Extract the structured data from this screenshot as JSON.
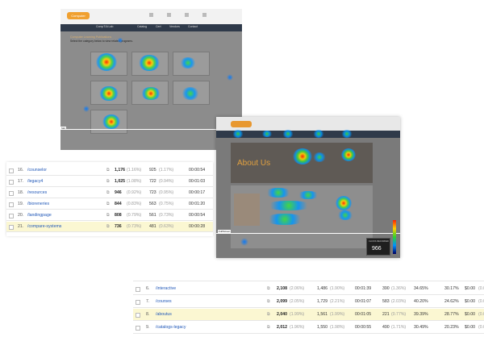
{
  "shot1": {
    "logo": "Computer",
    "nav": [
      "CompTIA Lab",
      "Catalog",
      "Cert",
      "Vendors",
      "Contact"
    ],
    "page_heading": "Computer Learning Publications",
    "page_subheading": "Select the category below to view related programs.",
    "label": "fold"
  },
  "shot2": {
    "hero_title": "About Us",
    "corner_label": "FullScreen",
    "clicks_label": "CLICKS RECORDED",
    "clicks_value": "966"
  },
  "table_top": {
    "rows": [
      {
        "idx": "16.",
        "url": "/counselor",
        "v1": "1,176",
        "p1": "(1.16%)",
        "v2": "925",
        "p2": "(1.17%)",
        "t": "00:00:54"
      },
      {
        "idx": "17.",
        "url": "/legacy4",
        "v1": "1,025",
        "p1": "(1.08%)",
        "v2": "722",
        "p2": "(0.94%)",
        "t": "00:01:03"
      },
      {
        "idx": "18.",
        "url": "/resources",
        "v1": "946",
        "p1": "(0.92%)",
        "v2": "723",
        "p2": "(0.95%)",
        "t": "00:00:17"
      },
      {
        "idx": "19.",
        "url": "/bioreneries",
        "v1": "844",
        "p1": "(0.83%)",
        "v2": "563",
        "p2": "(0.75%)",
        "t": "00:01:20"
      },
      {
        "idx": "20.",
        "url": "/landingpage",
        "v1": "808",
        "p1": "(0.79%)",
        "v2": "561",
        "p2": "(0.73%)",
        "t": "00:00:54"
      },
      {
        "idx": "21.",
        "url": "/compare-systems",
        "v1": "736",
        "p1": "(0.73%)",
        "v2": "481",
        "p2": "(0.63%)",
        "t": "00:00:28"
      }
    ]
  },
  "table_bottom": {
    "rows": [
      {
        "idx": "6.",
        "url": "/interactive",
        "v1": "2,108",
        "p1": "(2.06%)",
        "v2": "1,486",
        "p2": "(1.90%)",
        "t": "00:01:39",
        "b": "390",
        "bp": "(1.36%)",
        "r1": "34.65%",
        "r2": "30.17%",
        "m": "$0.00",
        "mp": "(0.00%)"
      },
      {
        "idx": "7.",
        "url": "/courses",
        "v1": "2,099",
        "p1": "(2.05%)",
        "v2": "1,729",
        "p2": "(2.21%)",
        "t": "00:01:07",
        "b": "583",
        "bp": "(2.03%)",
        "r1": "40.20%",
        "r2": "24.62%",
        "m": "$0.00",
        "mp": "(0.00%)"
      },
      {
        "idx": "8.",
        "url": "/aboutus",
        "v1": "2,040",
        "p1": "(1.99%)",
        "v2": "1,561",
        "p2": "(1.99%)",
        "t": "00:01:05",
        "b": "221",
        "bp": "(0.77%)",
        "r1": "39.39%",
        "r2": "28.77%",
        "m": "$0.00",
        "mp": "(0.00%)"
      },
      {
        "idx": "9.",
        "url": "/catalogs-legacy",
        "v1": "2,012",
        "p1": "(1.96%)",
        "v2": "1,550",
        "p2": "(1.98%)",
        "t": "00:00:55",
        "b": "490",
        "bp": "(1.71%)",
        "r1": "30.49%",
        "r2": "20.23%",
        "m": "$0.00",
        "mp": "(0.00%)"
      }
    ]
  }
}
